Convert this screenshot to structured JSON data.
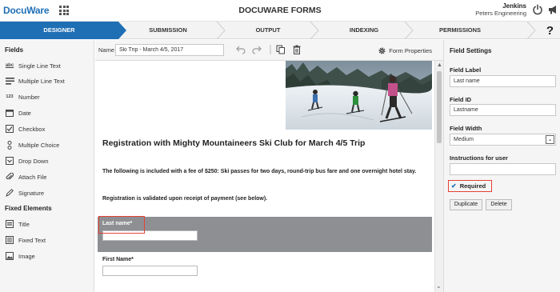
{
  "header": {
    "logo_text": "DocuWare",
    "app_title": "DOCUWARE FORMS",
    "user_name": "Jenkins",
    "user_org": "Peters Engineering"
  },
  "steps": [
    {
      "label": "DESIGNER",
      "active": true
    },
    {
      "label": "SUBMISSION",
      "active": false
    },
    {
      "label": "OUTPUT",
      "active": false
    },
    {
      "label": "INDEXING",
      "active": false
    },
    {
      "label": "PERMISSIONS",
      "active": false
    }
  ],
  "help_label": "?",
  "left_panel": {
    "fields_heading": "Fields",
    "fields": [
      {
        "label": "Single Line Text",
        "icon": "abc-icon"
      },
      {
        "label": "Multiple Line Text",
        "icon": "lines-icon"
      },
      {
        "label": "Number",
        "icon": "123-icon"
      },
      {
        "label": "Date",
        "icon": "calendar-icon"
      },
      {
        "label": "Checkbox",
        "icon": "checkbox-icon"
      },
      {
        "label": "Multiple Choice",
        "icon": "radio-icon"
      },
      {
        "label": "Drop Down",
        "icon": "dropdown-icon"
      },
      {
        "label": "Attach File",
        "icon": "paperclip-icon"
      },
      {
        "label": "Signature",
        "icon": "pen-icon"
      }
    ],
    "fixed_heading": "Fixed Elements",
    "fixed": [
      {
        "label": "Title",
        "icon": "title-icon"
      },
      {
        "label": "Fixed Text",
        "icon": "text-block-icon"
      },
      {
        "label": "Image",
        "icon": "image-icon"
      }
    ]
  },
  "toolbar": {
    "name_label": "Name",
    "name_value": "Ski Trip - March 4/5, 2017",
    "form_properties": "Form Properties"
  },
  "form": {
    "title": "Registration with Mighty Mountaineers Ski Club for March 4/5 Trip",
    "description": "The following is included with a fee of $250: Ski passes for two days, round-trip bus fare and one overnight hotel stay.",
    "note": "Registration is validated upon receipt of payment (see below).",
    "field1_label": "Last name*",
    "field2_label": "First Name*"
  },
  "right_panel": {
    "title": "Field Settings",
    "label_heading": "Field Label",
    "label_value": "Last name",
    "id_heading": "Field ID",
    "id_value": "Lastname",
    "width_heading": "Field Width",
    "width_value": "Medium",
    "instructions_heading": "Instructions for user",
    "instructions_value": "",
    "required_label": "Required",
    "duplicate_label": "Duplicate",
    "delete_label": "Delete"
  },
  "colors": {
    "accent": "#1f6fb5",
    "selected_field_bg": "#8e8f92",
    "highlight_red": "#e34234"
  }
}
